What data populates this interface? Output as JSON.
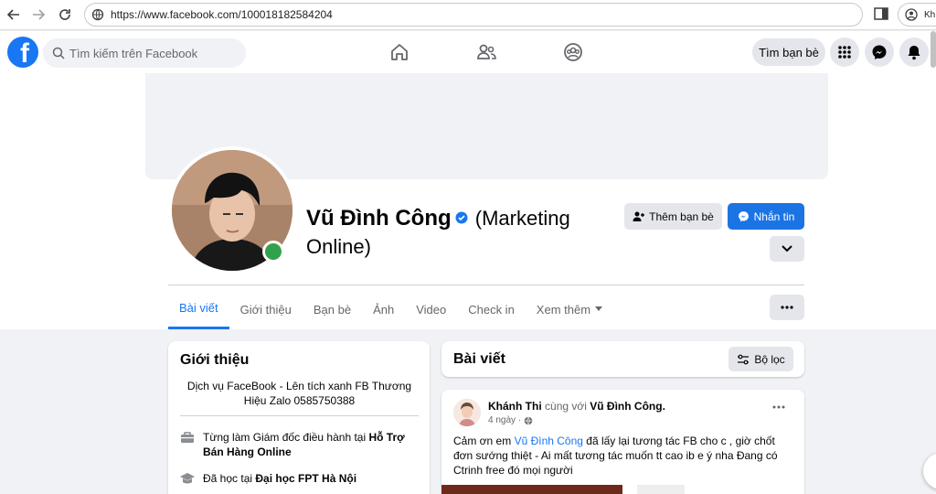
{
  "browser": {
    "url": "https://www.facebook.com/100018182584204",
    "profile_chip_label": "Kh"
  },
  "header": {
    "search_placeholder": "Tìm kiếm trên Facebook",
    "find_friends_label": "Tìm bạn bè"
  },
  "profile": {
    "name": "Vũ Đình Công",
    "name_suffix": "(Marketing Online)",
    "add_friend_label": "Thêm bạn bè",
    "message_label": "Nhắn tin"
  },
  "tabs": [
    {
      "label": "Bài viết",
      "active": true
    },
    {
      "label": "Giới thiệu"
    },
    {
      "label": "Bạn bè"
    },
    {
      "label": "Ảnh"
    },
    {
      "label": "Video"
    },
    {
      "label": "Check in"
    },
    {
      "label": "Xem thêm"
    }
  ],
  "intro": {
    "title": "Giới thiệu",
    "bio": "Dịch vụ FaceBook - Lên tích xanh FB Thương Hiệu Zalo 0585750388",
    "work_prefix": "Từng làm Giám đốc điều hành tại ",
    "work_place": "Hỗ Trợ Bán Hàng Online",
    "edu_prefix": "Đã học tại ",
    "edu_place": "Đại học FPT Hà Nội"
  },
  "posts": {
    "title": "Bài viết",
    "filter_label": "Bộ lọc"
  },
  "post": {
    "author": "Khánh Thi",
    "with_text": "cùng với",
    "tagged": "Vũ Đình Công.",
    "time": "4 ngày ·",
    "text_before": "Cảm ơn em ",
    "mention": "Vũ Đình Công",
    "text_after": " đã lấy lại tương tác FB cho c , giờ chốt đơn sướng thiệt - Ai mất tương tác muốn tt cao ib e ý nha Đang có Ctrinh free đó mọi người"
  },
  "colors": {
    "brand": "#1877f2",
    "online": "#31a24c",
    "page_bg": "#f0f2f5"
  }
}
